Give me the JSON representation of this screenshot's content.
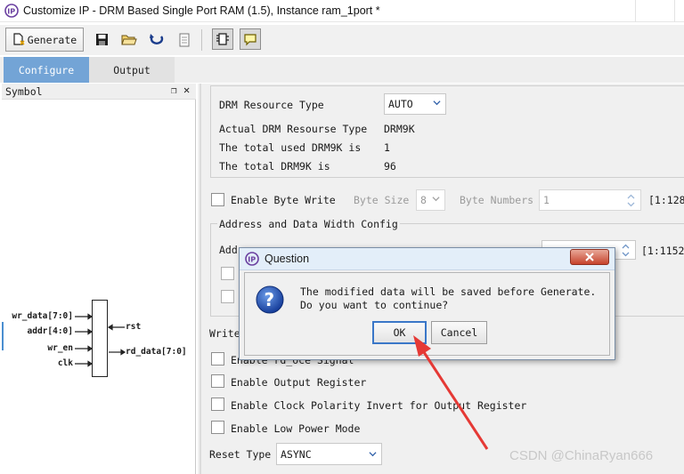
{
  "window": {
    "title": "Customize IP - DRM Based Single Port RAM (1.5), Instance ram_1port *",
    "logo_text": "IP"
  },
  "toolbar": {
    "generate_label": "Generate"
  },
  "tabs": [
    {
      "label": "Configure",
      "active": true
    },
    {
      "label": "Output",
      "active": false
    }
  ],
  "symbol_panel": {
    "title": "Symbol",
    "inputs": [
      "wr_data[7:0]",
      "addr[4:0]",
      "wr_en",
      "clk"
    ],
    "outputs": [
      "rst",
      "rd_data[7:0]"
    ]
  },
  "config": {
    "drm_resource_type_label": "DRM Resource Type",
    "drm_resource_type_value": "AUTO",
    "actual_drm_label": "Actual DRM Resourse Type",
    "actual_drm_value": "DRM9K",
    "total_used_label": "The total used DRM9K is",
    "total_used_value": "1",
    "total_label": "The total DRM9K is",
    "total_value": "96",
    "enable_byte_write_label": "Enable Byte Write",
    "byte_size_label": "Byte Size",
    "byte_size_value": "8",
    "byte_numbers_label": "Byte Numbers",
    "byte_numbers_value": "1",
    "byte_numbers_range": "[1:128",
    "addr_data_group_label": "Address and Data Width Config",
    "addr_partial_label": "Add",
    "addr_range": "[1:1152",
    "write_partial_label": "Write",
    "enable_rd_oce_label": "Enable rd_oce Signal",
    "enable_output_register_label": "Enable Output Register",
    "enable_clock_polarity_label": "Enable Clock Polarity Invert for Output Register",
    "enable_low_power_label": "Enable Low Power Mode",
    "reset_type_label": "Reset Type",
    "reset_type_value": "ASYNC"
  },
  "dialog": {
    "title": "Question",
    "message_line1": "The modified data will be saved before Generate.",
    "message_line2": "Do you want to continue?",
    "ok_label": "OK",
    "cancel_label": "Cancel"
  },
  "watermark": "CSDN @ChinaRyan666",
  "colors": {
    "tab_active": "#73a4d6",
    "dialog_close": "#c7432c",
    "annotation_arrow": "#e53935",
    "logo": "#6a3fa0"
  }
}
